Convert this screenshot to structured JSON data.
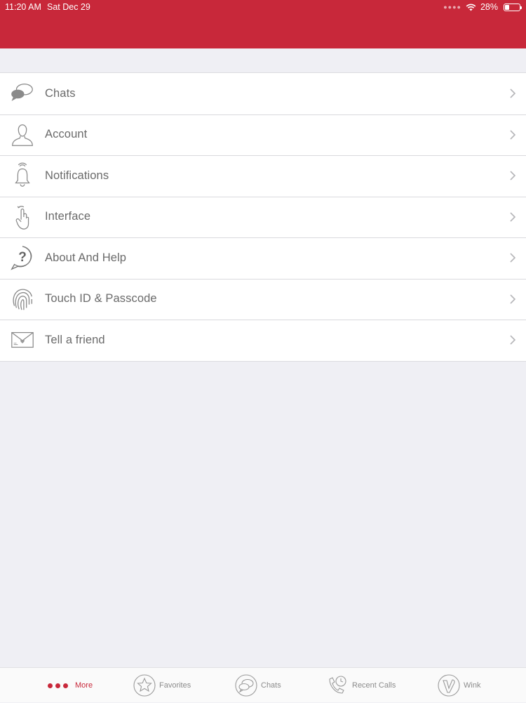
{
  "status_bar": {
    "time": "11:20 AM",
    "date": "Sat Dec 29",
    "battery": "28%"
  },
  "colors": {
    "brand": "#c8283a",
    "background": "#efeff4",
    "text": "#6a6a6a"
  },
  "menu": {
    "items": [
      {
        "label": "Chats",
        "icon": "chat-bubbles-icon"
      },
      {
        "label": "Account",
        "icon": "person-icon"
      },
      {
        "label": "Notifications",
        "icon": "bell-icon"
      },
      {
        "label": "Interface",
        "icon": "touch-hand-icon"
      },
      {
        "label": "About And Help",
        "icon": "question-icon"
      },
      {
        "label": "Touch ID & Passcode",
        "icon": "fingerprint-icon"
      },
      {
        "label": "Tell a friend",
        "icon": "envelope-icon"
      }
    ]
  },
  "tab_bar": {
    "tabs": [
      {
        "label": "More",
        "icon": "more-dots-icon",
        "active": true
      },
      {
        "label": "Favorites",
        "icon": "star-icon",
        "active": false
      },
      {
        "label": "Chats",
        "icon": "chat-bubbles-icon",
        "active": false
      },
      {
        "label": "Recent Calls",
        "icon": "phone-clock-icon",
        "active": false
      },
      {
        "label": "Wink",
        "icon": "wink-icon",
        "active": false
      }
    ]
  }
}
